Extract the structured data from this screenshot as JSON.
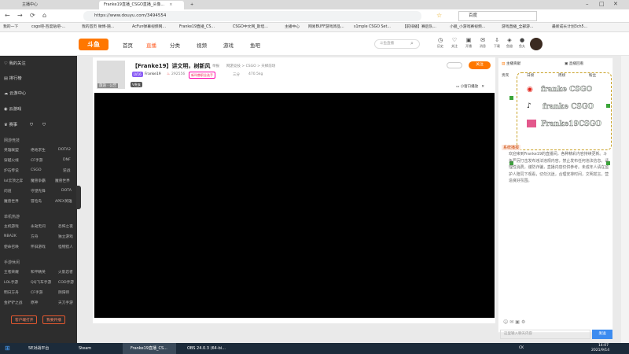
{
  "browser": {
    "tabs": [
      {
        "label": "主播中心"
      },
      {
        "label": "Franke19直播_CSGO直播_头像..."
      },
      {
        "label": "+"
      }
    ],
    "url": "https://www.douyu.com/3494554",
    "search_engine": "百度",
    "nav_back": "←",
    "nav_forward": "→",
    "nav_reload": "⟳",
    "home": "⌂",
    "star": "☆",
    "minimize": "–",
    "maximize": "□",
    "close": "✕"
  },
  "bookmarks": [
    {
      "label": "我的一下"
    },
    {
      "label": "csgo吧-百度贴吧-..."
    },
    {
      "label": "我的首页 微博-随..."
    },
    {
      "label": "AcFun弹幕视频网..."
    },
    {
      "label": "Franke19直播_CS..."
    },
    {
      "label": "CSGO中文网_斯坦..."
    },
    {
      "label": "主播中心"
    },
    {
      "label": "网易BUFF游戏饰品..."
    },
    {
      "label": "s1mple CSGO Set..."
    },
    {
      "label": "【前排播】赛后队..."
    },
    {
      "label": "小舰_小游戏赛视频..."
    },
    {
      "label": "游戏直播_全部游..."
    },
    {
      "label": "最新成长计划3ch5..."
    }
  ],
  "site": {
    "logo": "斗鱼",
    "nav": [
      {
        "label": "首页"
      },
      {
        "label": "直播"
      },
      {
        "label": "分类"
      },
      {
        "label": "视频"
      },
      {
        "label": "游戏"
      },
      {
        "label": "鱼吧"
      }
    ],
    "search_placeholder": "斗鱼直播",
    "header_icons": [
      {
        "label": "历史"
      },
      {
        "label": "关注"
      },
      {
        "label": "开播"
      },
      {
        "label": "消息"
      },
      {
        "label": "下载"
      },
      {
        "label": "鱼翅"
      },
      {
        "label": "鱼丸"
      },
      {
        "label": "创作中心"
      }
    ]
  },
  "sidebar": {
    "items": [
      {
        "label": "我的关注"
      },
      {
        "label": "排行榜"
      },
      {
        "label": "云游中心"
      },
      {
        "label": "云游戏"
      },
      {
        "label": "赛事"
      }
    ],
    "groups": [
      {
        "title": "网游竞技",
        "items": [
          "英雄联盟",
          "绝地求生",
          "DOTA2",
          "穿越火线",
          "CF手游",
          "DNF",
          "炉石传说",
          "CSGO",
          "逆战",
          "lol云顶之弈",
          "魔兽争霸",
          "魔兽世界",
          "问道",
          "守望先锋",
          "DOTA",
          "魔兽世界",
          "冒险岛",
          "APEX英雄"
        ]
      },
      {
        "title": "单机热游",
        "items": [
          "主机游戏",
          "永劫无间",
          "恐怖之夜",
          "怀旧游戏",
          "主机",
          "恐怖游戏",
          "NBA2K",
          "方舟",
          "独立游戏",
          "我的世界",
          "使命召唤",
          "怪物猎人"
        ]
      },
      {
        "title": "手游休闲",
        "items": [
          "王者荣耀",
          "和平精英",
          "火影忍者",
          "LOL手游",
          "QQ飞车手游",
          "COD手游",
          "明日方舟",
          "CF手游",
          "阴阳师",
          "金铲铲之战",
          "原神",
          "天刀手游"
        ]
      }
    ],
    "btn_download": "客户端打开",
    "btn_start": "我要开播"
  },
  "room": {
    "title": "【Franke19】讲文明，树新风",
    "report": "举报",
    "category": "网游竞技 > CSGO > 天梯前场",
    "level": "LV16",
    "anchor": "Franke19",
    "hot": "292556",
    "badge": "新叫兽职业选手",
    "rank_text": "三分",
    "weight": "470.5kg",
    "follow": "关注",
    "thumb_tag": "旅途 · 公告",
    "vip_tag": "V贵族",
    "mini_window": "小窗口播放"
  },
  "right": {
    "tabs": [
      {
        "label": "主播贡献"
      },
      {
        "label": "直播回看"
      }
    ],
    "sub_tabs": [
      {
        "label": "贵宾"
      },
      {
        "label": "日榜"
      },
      {
        "label": "周榜"
      },
      {
        "label": "粉丝"
      }
    ],
    "overlay_lines": [
      "franke CSGO",
      "franke CSGO",
      "Franke19CSGO"
    ],
    "notice_label": "系统播报",
    "chat_text": "欢迎来到Franke19的直播间，各种精彩内容持续更新。斗鱼严厉打击发布违法违规内容，禁止发布任何违法信息。请理性消费，谨防诈骗，直播内容仅供参考。未成年人请在监护人陪同下观看，切勿沉迷，合理安排时间，文明发言，营造良好氛围。",
    "chat_placeholder": "这里输入聊天内容",
    "send": "发送"
  },
  "taskbar": {
    "start": "⊞",
    "apps": [
      {
        "label": "5E对战平台"
      },
      {
        "label": "Steam"
      },
      {
        "label": "Franke19直播_CS..."
      },
      {
        "label": "OBS 24.0.3 (64-bi..."
      }
    ],
    "tray_text": "CK",
    "time": "14:07",
    "date": "2021/9/14"
  }
}
